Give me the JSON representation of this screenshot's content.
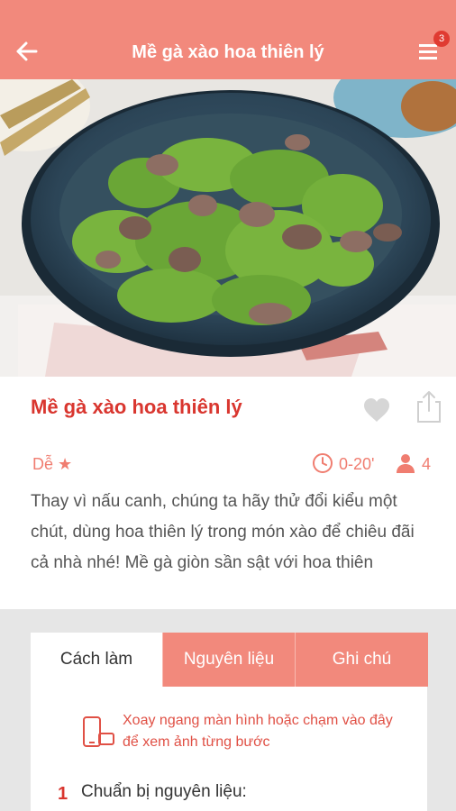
{
  "header": {
    "title": "Mề gà xào hoa thiên lý",
    "back_icon": "arrow-left-icon",
    "menu_icon": "list-menu-icon",
    "badge_count": "3",
    "bg_color": "#f2897c"
  },
  "recipe": {
    "title": "Mề gà xào hoa thiên lý",
    "difficulty": "Dễ ★",
    "time": "0-20'",
    "servings": "4",
    "description": "Thay vì nấu canh, chúng ta hãy thử đổi kiểu một chút, dùng hoa thiên lý trong món xào để chiêu đãi cả nhà nhé! Mề gà giòn sần sật với hoa thiên",
    "accent_color": "#d9362f"
  },
  "tabs": {
    "items": [
      {
        "label": "Cách làm",
        "active": true
      },
      {
        "label": "Nguyên liệu",
        "active": false
      },
      {
        "label": "Ghi chú",
        "active": false
      }
    ]
  },
  "instructions": {
    "rotate_hint": "Xoay ngang màn hình hoặc chạm vào đây để xem ảnh từng bước",
    "steps": [
      {
        "number": "1",
        "text": "Chuẩn bị nguyên liệu:"
      }
    ]
  }
}
